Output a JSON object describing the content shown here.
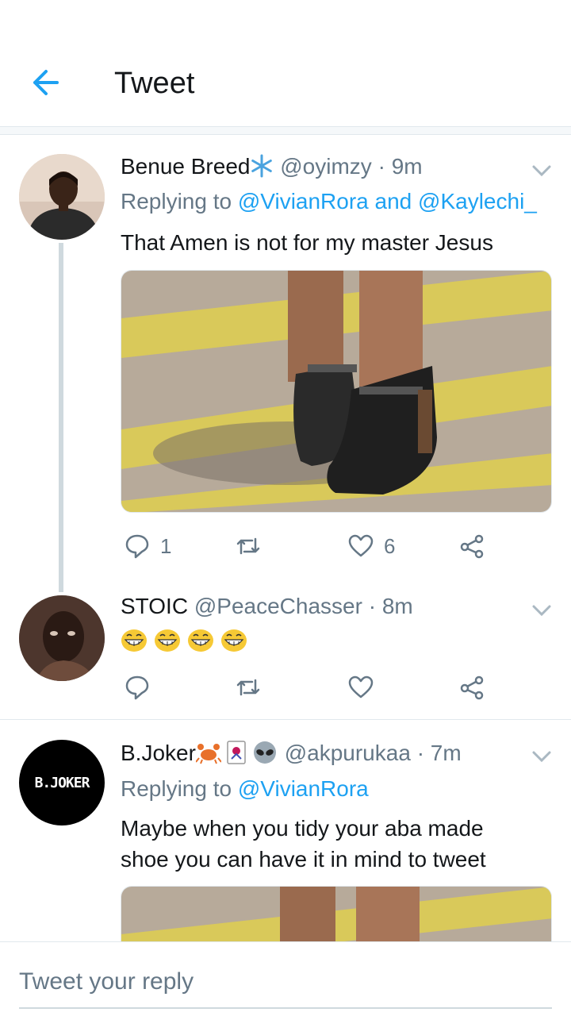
{
  "header": {
    "title": "Tweet",
    "back_icon": "back-arrow-icon"
  },
  "colors": {
    "accent": "#1da1f2",
    "muted": "#657786",
    "text": "#14171a",
    "divider": "#e1e8ed",
    "thread": "#cfd9de"
  },
  "tweets": [
    {
      "name": "Benue Breed",
      "name_emoji": "snowflake-icon",
      "handle": "@oyimzy",
      "time": "9m",
      "reply_prefix": "Replying to",
      "mentions": [
        "@VivianRora",
        "@Kaylechi_"
      ],
      "mention_joiner": "and",
      "text": "That Amen is not for my master Jesus",
      "media": "photo of shoes on a road",
      "actions": {
        "replies": "1",
        "retweets": "",
        "likes": "6"
      }
    },
    {
      "name": "STOIC",
      "handle": "@PeaceChasser",
      "time": "8m",
      "emojis": [
        "grinning-face-icon",
        "grinning-face-icon",
        "grinning-face-icon",
        "grinning-face-icon"
      ],
      "actions": {
        "replies": "",
        "retweets": "",
        "likes": ""
      }
    },
    {
      "name": "B.Joker",
      "name_emojis": [
        "crab-icon",
        "joker-card-icon",
        "alien-icon"
      ],
      "avatar_text": "B.JOKER",
      "handle": "@akpurukaa",
      "time": "7m",
      "reply_prefix": "Replying to",
      "mentions": [
        "@VivianRora"
      ],
      "text_lines": [
        "Maybe when you tidy your aba made",
        "shoe you can have it in mind to tweet"
      ]
    }
  ],
  "reply": {
    "placeholder": "Tweet your reply"
  },
  "separator": "·"
}
